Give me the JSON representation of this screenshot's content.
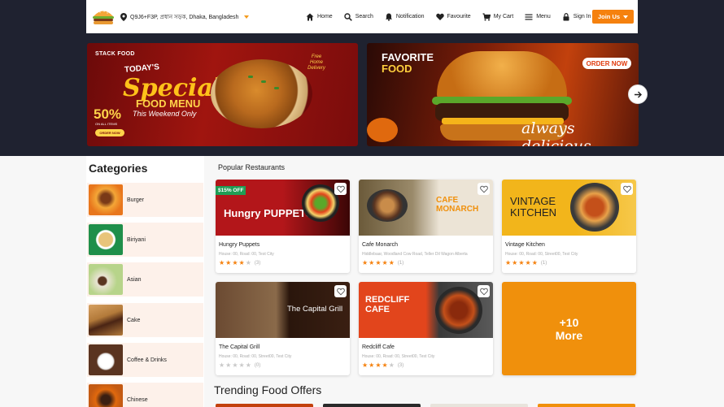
{
  "header": {
    "location": "Q9J6+F3P, প্রধান সড়ক, Dhaka, Bangladesh",
    "nav": [
      {
        "label": "Home",
        "icon": "home-icon"
      },
      {
        "label": "Search",
        "icon": "search-icon"
      },
      {
        "label": "Notification",
        "icon": "bell-icon"
      },
      {
        "label": "Favourite",
        "icon": "heart-icon"
      },
      {
        "label": "My Cart",
        "icon": "cart-icon"
      },
      {
        "label": "Menu",
        "icon": "menu-icon"
      },
      {
        "label": "Sign In",
        "icon": "lock-icon"
      }
    ],
    "join_label": "Join Us"
  },
  "banners": {
    "banner1": {
      "brand": "STACK FOOD",
      "today": "TODAY'S",
      "special": "Special",
      "menu": "FOOD MENU",
      "weekend": "This Weekend Only",
      "discount": "50%",
      "discount_sub": "ON ALL ITEMS",
      "order": "ORDER NOW",
      "free": "Free Home Delivery"
    },
    "banner2": {
      "line1": "FAVORITE",
      "line2": "FOOD",
      "order": "ORDER NOW",
      "tagline": "always delicious"
    }
  },
  "categories": {
    "title": "Categories",
    "items": [
      {
        "label": "Burger",
        "color": "#e8761c"
      },
      {
        "label": "Biriyani",
        "color": "#1f8f4a"
      },
      {
        "label": "Asian",
        "color": "#b7d48a"
      },
      {
        "label": "Cake",
        "color": "#b37a3a"
      },
      {
        "label": "Coffee & Drinks",
        "color": "#5a3420"
      },
      {
        "label": "Chinese",
        "color": "#e0690e"
      }
    ]
  },
  "popular": {
    "title": "Popular Restaurants",
    "cards": [
      {
        "name": "Hungry Puppets",
        "address": "House: 00, Road: 00, Test City",
        "rating": 4,
        "count": "(3)",
        "badge": "$15% OFF",
        "img_text": "Hungry PUPPETS",
        "bg": "#b3161a"
      },
      {
        "name": "Cafe Monarch",
        "address": "Hiddlebaar, Woodland Cow Road, Teller Dil Wagon Alberta",
        "rating": 5,
        "count": "(1)",
        "img_text": "CAFE MONARCH",
        "bg": "#ece4d6"
      },
      {
        "name": "Vintage Kitchen",
        "address": "House: 00, Road: 00, Street00, Test City",
        "rating": 5,
        "count": "(1)",
        "img_text": "VINTAGE KITCHEN",
        "bg": "#f2b51b"
      },
      {
        "name": "The Capital Grill",
        "address": "House: 00, Road: 00, Street00, Test City",
        "rating": 0,
        "count": "(0)",
        "img_text": "The Capital Grill",
        "bg": "#3a1f12"
      },
      {
        "name": "Redcliff Cafe",
        "address": "House: 00, Road: 00, Street00, Test City",
        "rating": 4,
        "count": "(3)",
        "img_text": "REDCLIFF CAFE",
        "bg": "#e2451c"
      }
    ],
    "more_count": "+10",
    "more_label": "More"
  },
  "trending": {
    "title": "Trending Food Offers"
  }
}
